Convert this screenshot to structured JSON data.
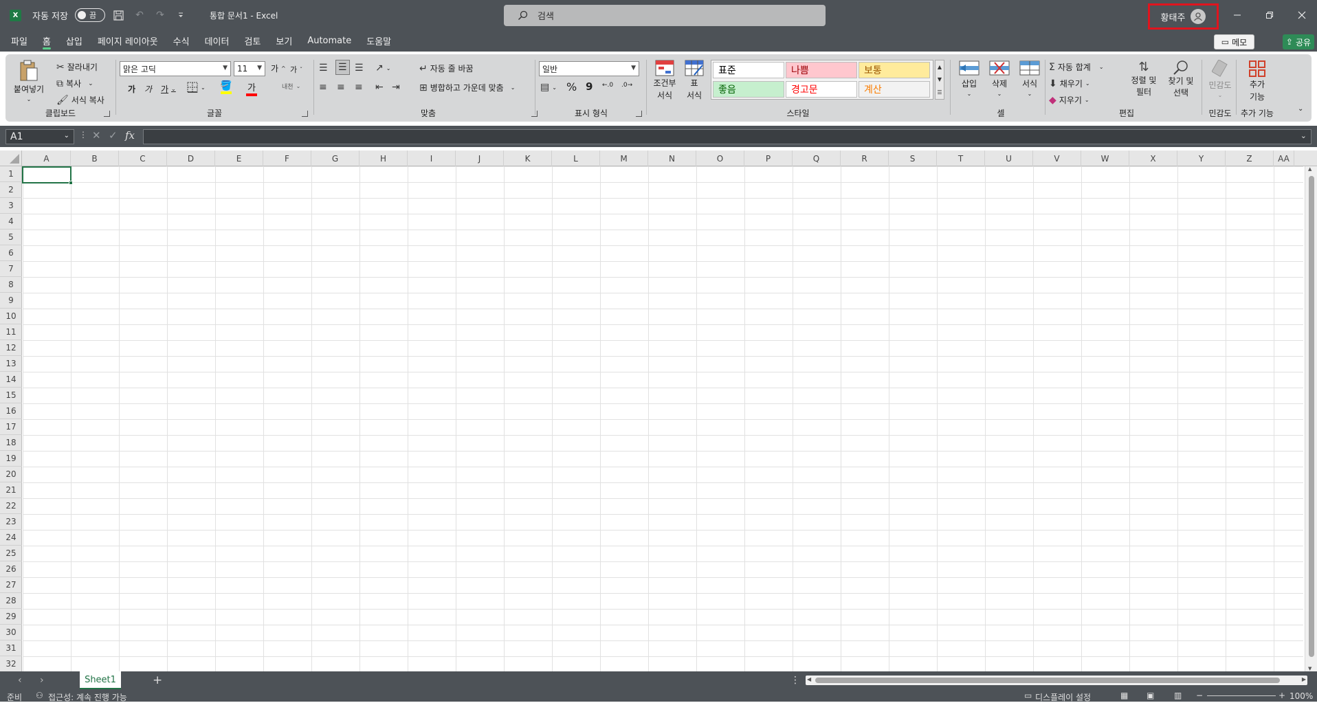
{
  "titlebar": {
    "app_logo": "X",
    "autosave_label": "자동 저장",
    "autosave_state": "끔",
    "doc_title": "통합 문서1  -  Excel",
    "user_name": "황태주"
  },
  "search": {
    "placeholder": "검색"
  },
  "menu": {
    "items": [
      "파일",
      "홈",
      "삽입",
      "페이지 레이아웃",
      "수식",
      "데이터",
      "검토",
      "보기",
      "Automate",
      "도움말"
    ],
    "active": "홈",
    "memo_label": "메모",
    "share_label": "공유"
  },
  "ribbon": {
    "clipboard": {
      "label": "클립보드",
      "paste": "붙여넣기",
      "cut": "잘라내기",
      "copy": "복사",
      "format_painter": "서식 복사"
    },
    "font": {
      "label": "글꼴",
      "font_name": "맑은 고딕",
      "font_size": "11",
      "grow": "가",
      "shrink": "가",
      "bold": "가",
      "italic": "가",
      "underline": "가",
      "font_color": "가",
      "phonetic": "내천"
    },
    "alignment": {
      "label": "맞춤",
      "wrap": "자동 줄 바꿈",
      "merge": "병합하고 가운데 맞춤"
    },
    "number": {
      "label": "표시 형식",
      "format": "일반",
      "percent": "%",
      "comma": "9"
    },
    "styles": {
      "label": "스타일",
      "conditional": [
        "조건부",
        "서식"
      ],
      "table": [
        "표",
        "서식"
      ],
      "cells": [
        {
          "text": "표준",
          "bg": "#ffffff",
          "fg": "#000000"
        },
        {
          "text": "나쁨",
          "bg": "#ffc7ce",
          "fg": "#9c0006"
        },
        {
          "text": "보통",
          "bg": "#ffeb9c",
          "fg": "#9c5700"
        },
        {
          "text": "좋음",
          "bg": "#c6efce",
          "fg": "#006100"
        },
        {
          "text": "경고문",
          "bg": "#ffffff",
          "fg": "#ff0000"
        },
        {
          "text": "계산",
          "bg": "#f2f2f2",
          "fg": "#fa7d00"
        }
      ]
    },
    "cells": {
      "label": "셀",
      "insert": "삽입",
      "delete": "삭제",
      "format": "서식"
    },
    "editing": {
      "label": "편집",
      "autosum": "자동 합계",
      "fill": "채우기",
      "clear": "지우기",
      "sort": [
        "정렬 및",
        "필터"
      ],
      "find": [
        "찾기 및",
        "선택"
      ]
    },
    "sensitivity": {
      "label": "민감도",
      "button": "민감도"
    },
    "addins": {
      "label": "추가 기능",
      "button": [
        "추가",
        "기능"
      ]
    }
  },
  "formula": {
    "namebox": "A1",
    "fx": "fx"
  },
  "grid": {
    "columns": [
      "A",
      "B",
      "C",
      "D",
      "E",
      "F",
      "G",
      "H",
      "I",
      "J",
      "K",
      "L",
      "M",
      "N",
      "O",
      "P",
      "Q",
      "R",
      "S",
      "T",
      "U",
      "V",
      "W",
      "X",
      "Y",
      "Z",
      "AA"
    ],
    "rows": [
      "1",
      "2",
      "3",
      "4",
      "5",
      "6",
      "7",
      "8",
      "9",
      "10",
      "11",
      "12",
      "13",
      "14",
      "15",
      "16",
      "17",
      "18",
      "19",
      "20",
      "21",
      "22",
      "23",
      "24",
      "25",
      "26",
      "27",
      "28",
      "29",
      "30",
      "31",
      "32"
    ]
  },
  "sheets": {
    "tabs": [
      "Sheet1"
    ],
    "add": "+"
  },
  "status": {
    "ready": "준비",
    "accessibility": "접근성: 계속 진행 가능",
    "display": "디스플레이 설정",
    "zoom": "100%"
  },
  "colors": {
    "accent": "#217346",
    "chrome": "#4d5257",
    "highlight_box": "#e0141e"
  }
}
